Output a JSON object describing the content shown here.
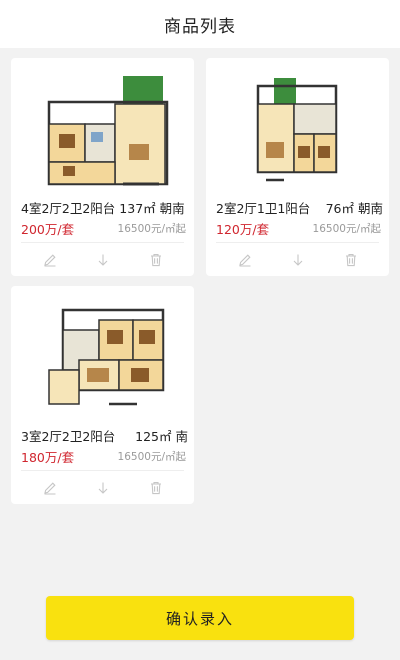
{
  "header": {
    "title": "商品列表"
  },
  "cards": [
    {
      "title_left": "4室2厅2卫2阳台 137㎡ 朝南",
      "price": "200万/套",
      "unit_price": "16500元/㎡起",
      "actions": [
        "edit-icon",
        "download-icon",
        "delete-icon"
      ]
    },
    {
      "title_left": "2室2厅1卫1阳台",
      "title_right": "76㎡ 朝南",
      "price": "120万/套",
      "unit_price": "16500元/㎡起",
      "actions": [
        "edit-icon",
        "download-icon",
        "delete-icon"
      ]
    },
    {
      "title_left": "3室2厅2卫2阳台",
      "title_right": "125㎡ 南",
      "price": "180万/套",
      "unit_price": "16500元/㎡起",
      "actions": [
        "edit-icon",
        "download-icon",
        "delete-icon"
      ]
    }
  ],
  "footer": {
    "confirm_label": "确认录入"
  },
  "colors": {
    "accent": "#f9e10f",
    "price": "#d0262f",
    "background": "#f2f2f2"
  }
}
